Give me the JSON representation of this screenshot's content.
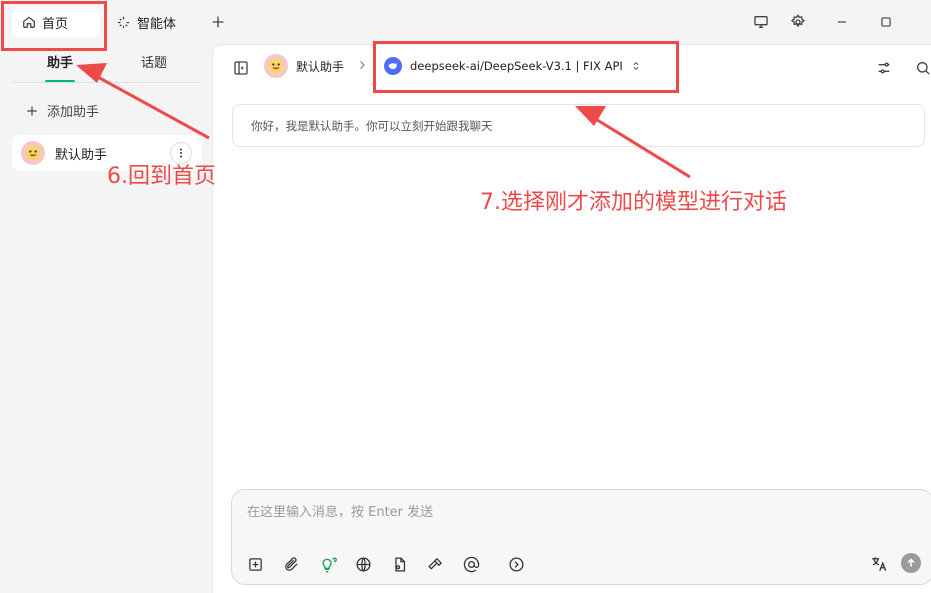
{
  "topbar": {
    "home_tab": {
      "label": "首页",
      "icon": "home-icon"
    },
    "agents_tab": {
      "label": "智能体",
      "icon": "sparkle-icon"
    },
    "add_tab_icon": "plus-icon",
    "window_icons": [
      "monitor-icon",
      "gear-icon",
      "minimize-icon",
      "maximize-icon"
    ]
  },
  "sidebar": {
    "tabs": [
      {
        "label": "助手",
        "active": true
      },
      {
        "label": "话题",
        "active": false
      }
    ],
    "add_assistant_label": "添加助手",
    "assistants": [
      {
        "name": "默认助手"
      }
    ]
  },
  "chat_header": {
    "assistant_name": "默认助手",
    "model_name": "deepseek-ai/DeepSeek-V3.1 | FIX API"
  },
  "welcome_message": "你好，我是默认助手。你可以立刻开始跟我聊天",
  "composer": {
    "placeholder": "在这里输入消息，按 Enter 发送",
    "tools": [
      "new-topic-icon",
      "attachment-icon",
      "lightbulb-icon",
      "globe-icon",
      "file-icon",
      "hammer-icon",
      "at-icon",
      "chevron-circle-icon"
    ]
  },
  "annotations": {
    "step6": "6.回到首页",
    "step7": "7.选择刚才添加的模型进行对话",
    "color": "#ef4a4a"
  },
  "colors": {
    "accent": "#00b96b",
    "model_logo": "#4d6bfe"
  }
}
